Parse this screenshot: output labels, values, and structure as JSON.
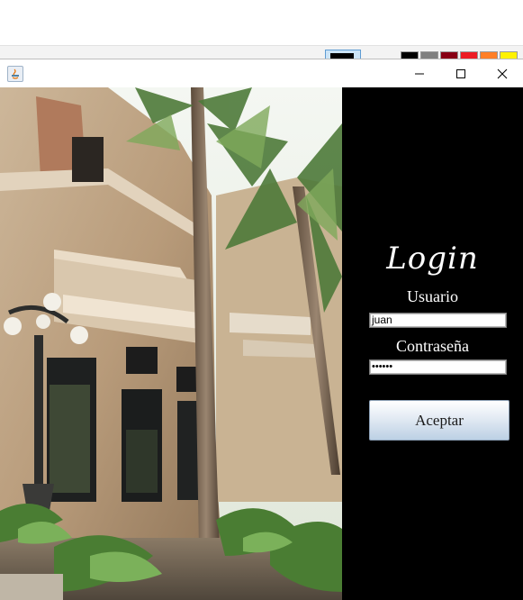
{
  "window": {
    "minimize_symbol": "—",
    "maximize_symbol": "☐",
    "close_symbol": "✕"
  },
  "login": {
    "title": "Login",
    "user_label": "Usuario",
    "user_value": "juan",
    "password_label": "Contraseña",
    "password_value": "••••••",
    "submit_label": "Aceptar"
  },
  "background_app": {
    "palette_colors": [
      "#000000",
      "#7f7f7f",
      "#880015",
      "#ed1c24",
      "#ff7f27",
      "#fff200"
    ]
  },
  "icons": [
    "java-icon",
    "minimize-icon",
    "maximize-icon",
    "close-icon"
  ]
}
